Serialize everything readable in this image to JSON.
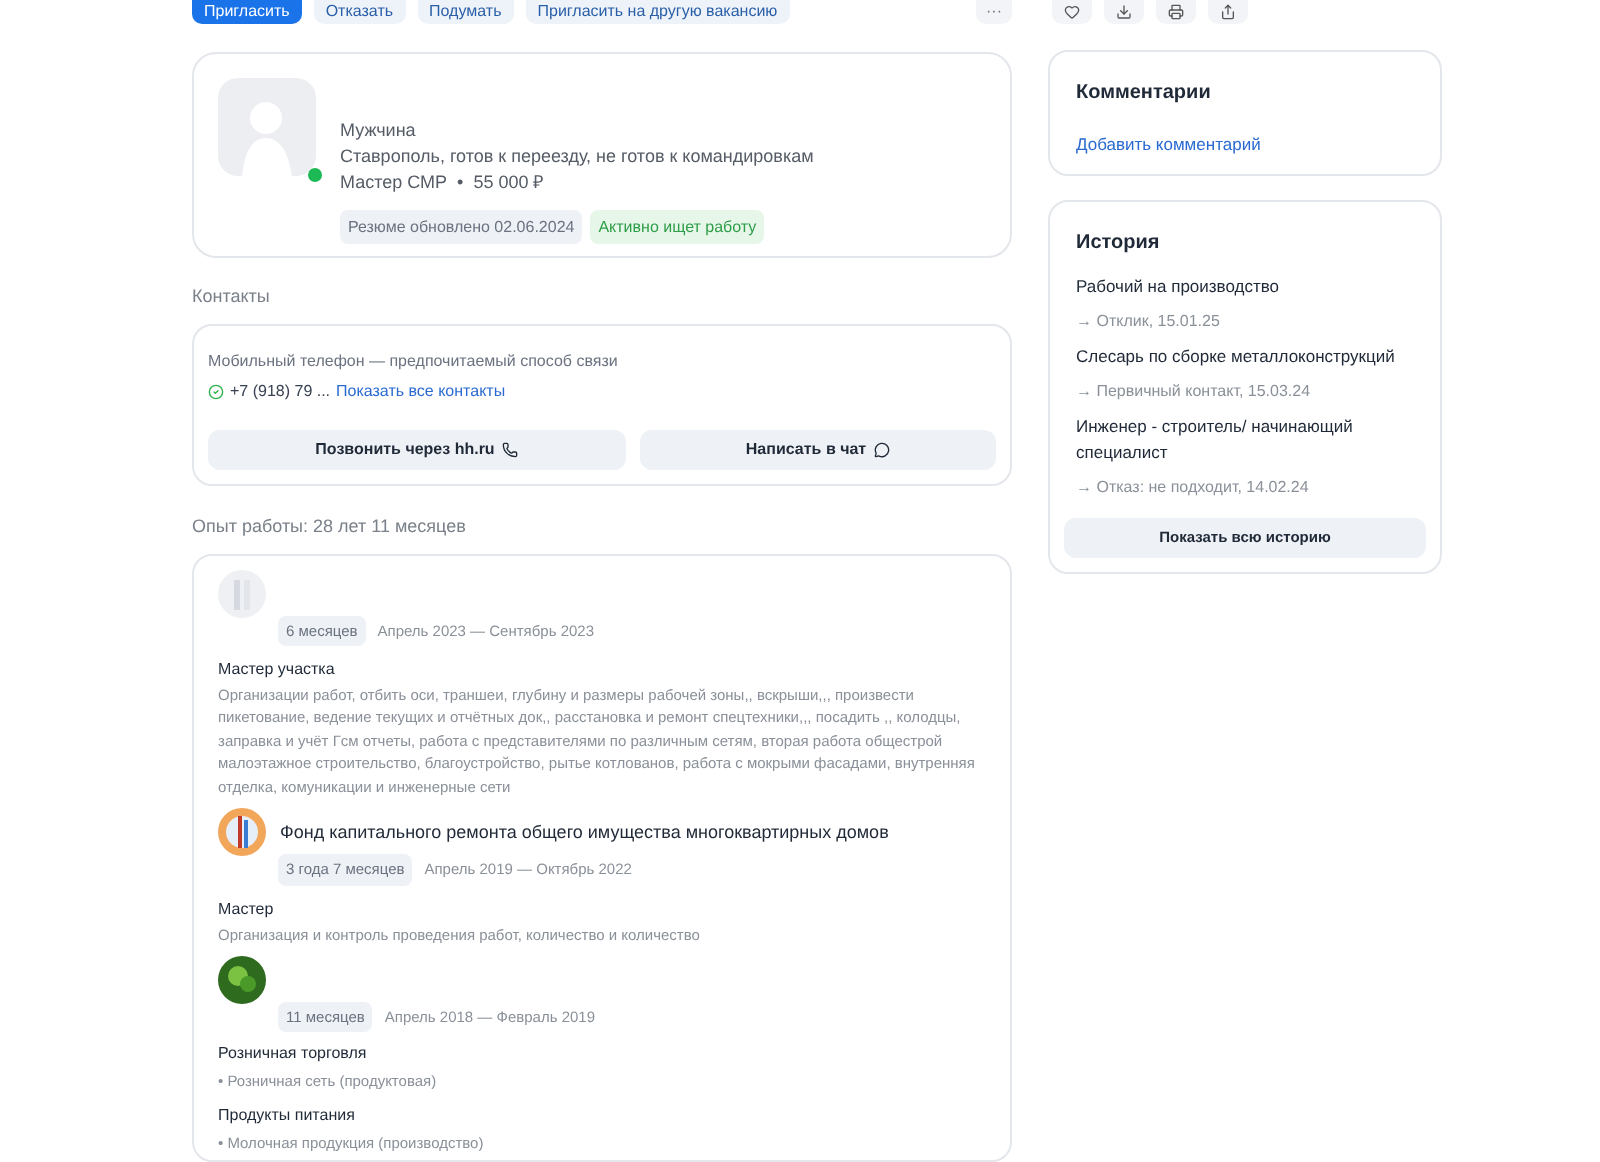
{
  "actions": [
    "Пригласить",
    "Отказать",
    "Подумать",
    "Пригласить на другую вакансию"
  ],
  "more_button": "···",
  "profile": {
    "gender": "Мужчина",
    "location": "Ставрополь, готов к переезду, не готов к командировкам",
    "position": "Мастер СМР",
    "separator": "•",
    "salary": "55 000 ₽",
    "online": true,
    "tags": [
      {
        "label": "Резюме обновлено 02.06.2024",
        "kind": "neutral"
      },
      {
        "label": "Активно ищет работу",
        "kind": "positive"
      }
    ]
  },
  "contacts": {
    "heading": "Контакты",
    "note": "Мобильный телефон — предпочитаемый способ связи",
    "phone": "+7 (918) 79 ...",
    "show_all": "Показать все контакты",
    "call_button": "Позвонить через hh.ru",
    "chat_button": "Написать в чат"
  },
  "experience": {
    "heading": "Опыт работы: 28 лет 11 месяцев",
    "jobs": [
      {
        "duration": "6 месяцев",
        "dates": "Апрель 2023 — Сентябрь 2023",
        "position": "Мастер участка",
        "description": "Организации работ, отбить оси, траншеи, глубину и размеры рабочей зоны,, вскрыши,,, произвести пикетование, ведение текущих и отчётных док,, расстановка и ремонт спецтехники,,, посадить ,, колодцы, заправка и учёт Гсм отчеты, работа с представителями по различным сетям, вторая работа общестрой малоэтажное строительство, благоустройство, рытье котлованов, работа с мокрыми фасадами, внутренняя отделка, комуникации и инженерные сети"
      },
      {
        "company": "Фонд капитального ремонта общего имущества многоквартирных домов",
        "duration": "3 года 7 месяцев",
        "dates": "Апрель 2019 — Октябрь 2022",
        "position": "Мастер",
        "description": "Организация и контроль проведения работ, количество и количество"
      },
      {
        "duration": "11 месяцев",
        "dates": "Апрель 2018 — Февраль 2019",
        "industries": [
          {
            "name": "Розничная торговля",
            "items": [
              "• Розничная сеть (продуктовая)"
            ]
          },
          {
            "name": "Продукты питания",
            "items": [
              "• Молочная продукция (производство)"
            ]
          }
        ]
      }
    ]
  },
  "comments": {
    "title": "Комментарии",
    "add_link": "Добавить комментарий"
  },
  "history": {
    "title": "История",
    "items": [
      {
        "vacancy": "Рабочий на производство",
        "status": "→ Отклик, 15.01.25"
      },
      {
        "vacancy": "Слесарь по сборке металлоконструкций",
        "status": "→ Первичный контакт, 15.03.24"
      },
      {
        "vacancy": "Инженер - строитель/ начинающий специалист",
        "status": "→ Отказ: не подходит, 14.02.24"
      }
    ],
    "show_all": "Показать всю историю"
  }
}
